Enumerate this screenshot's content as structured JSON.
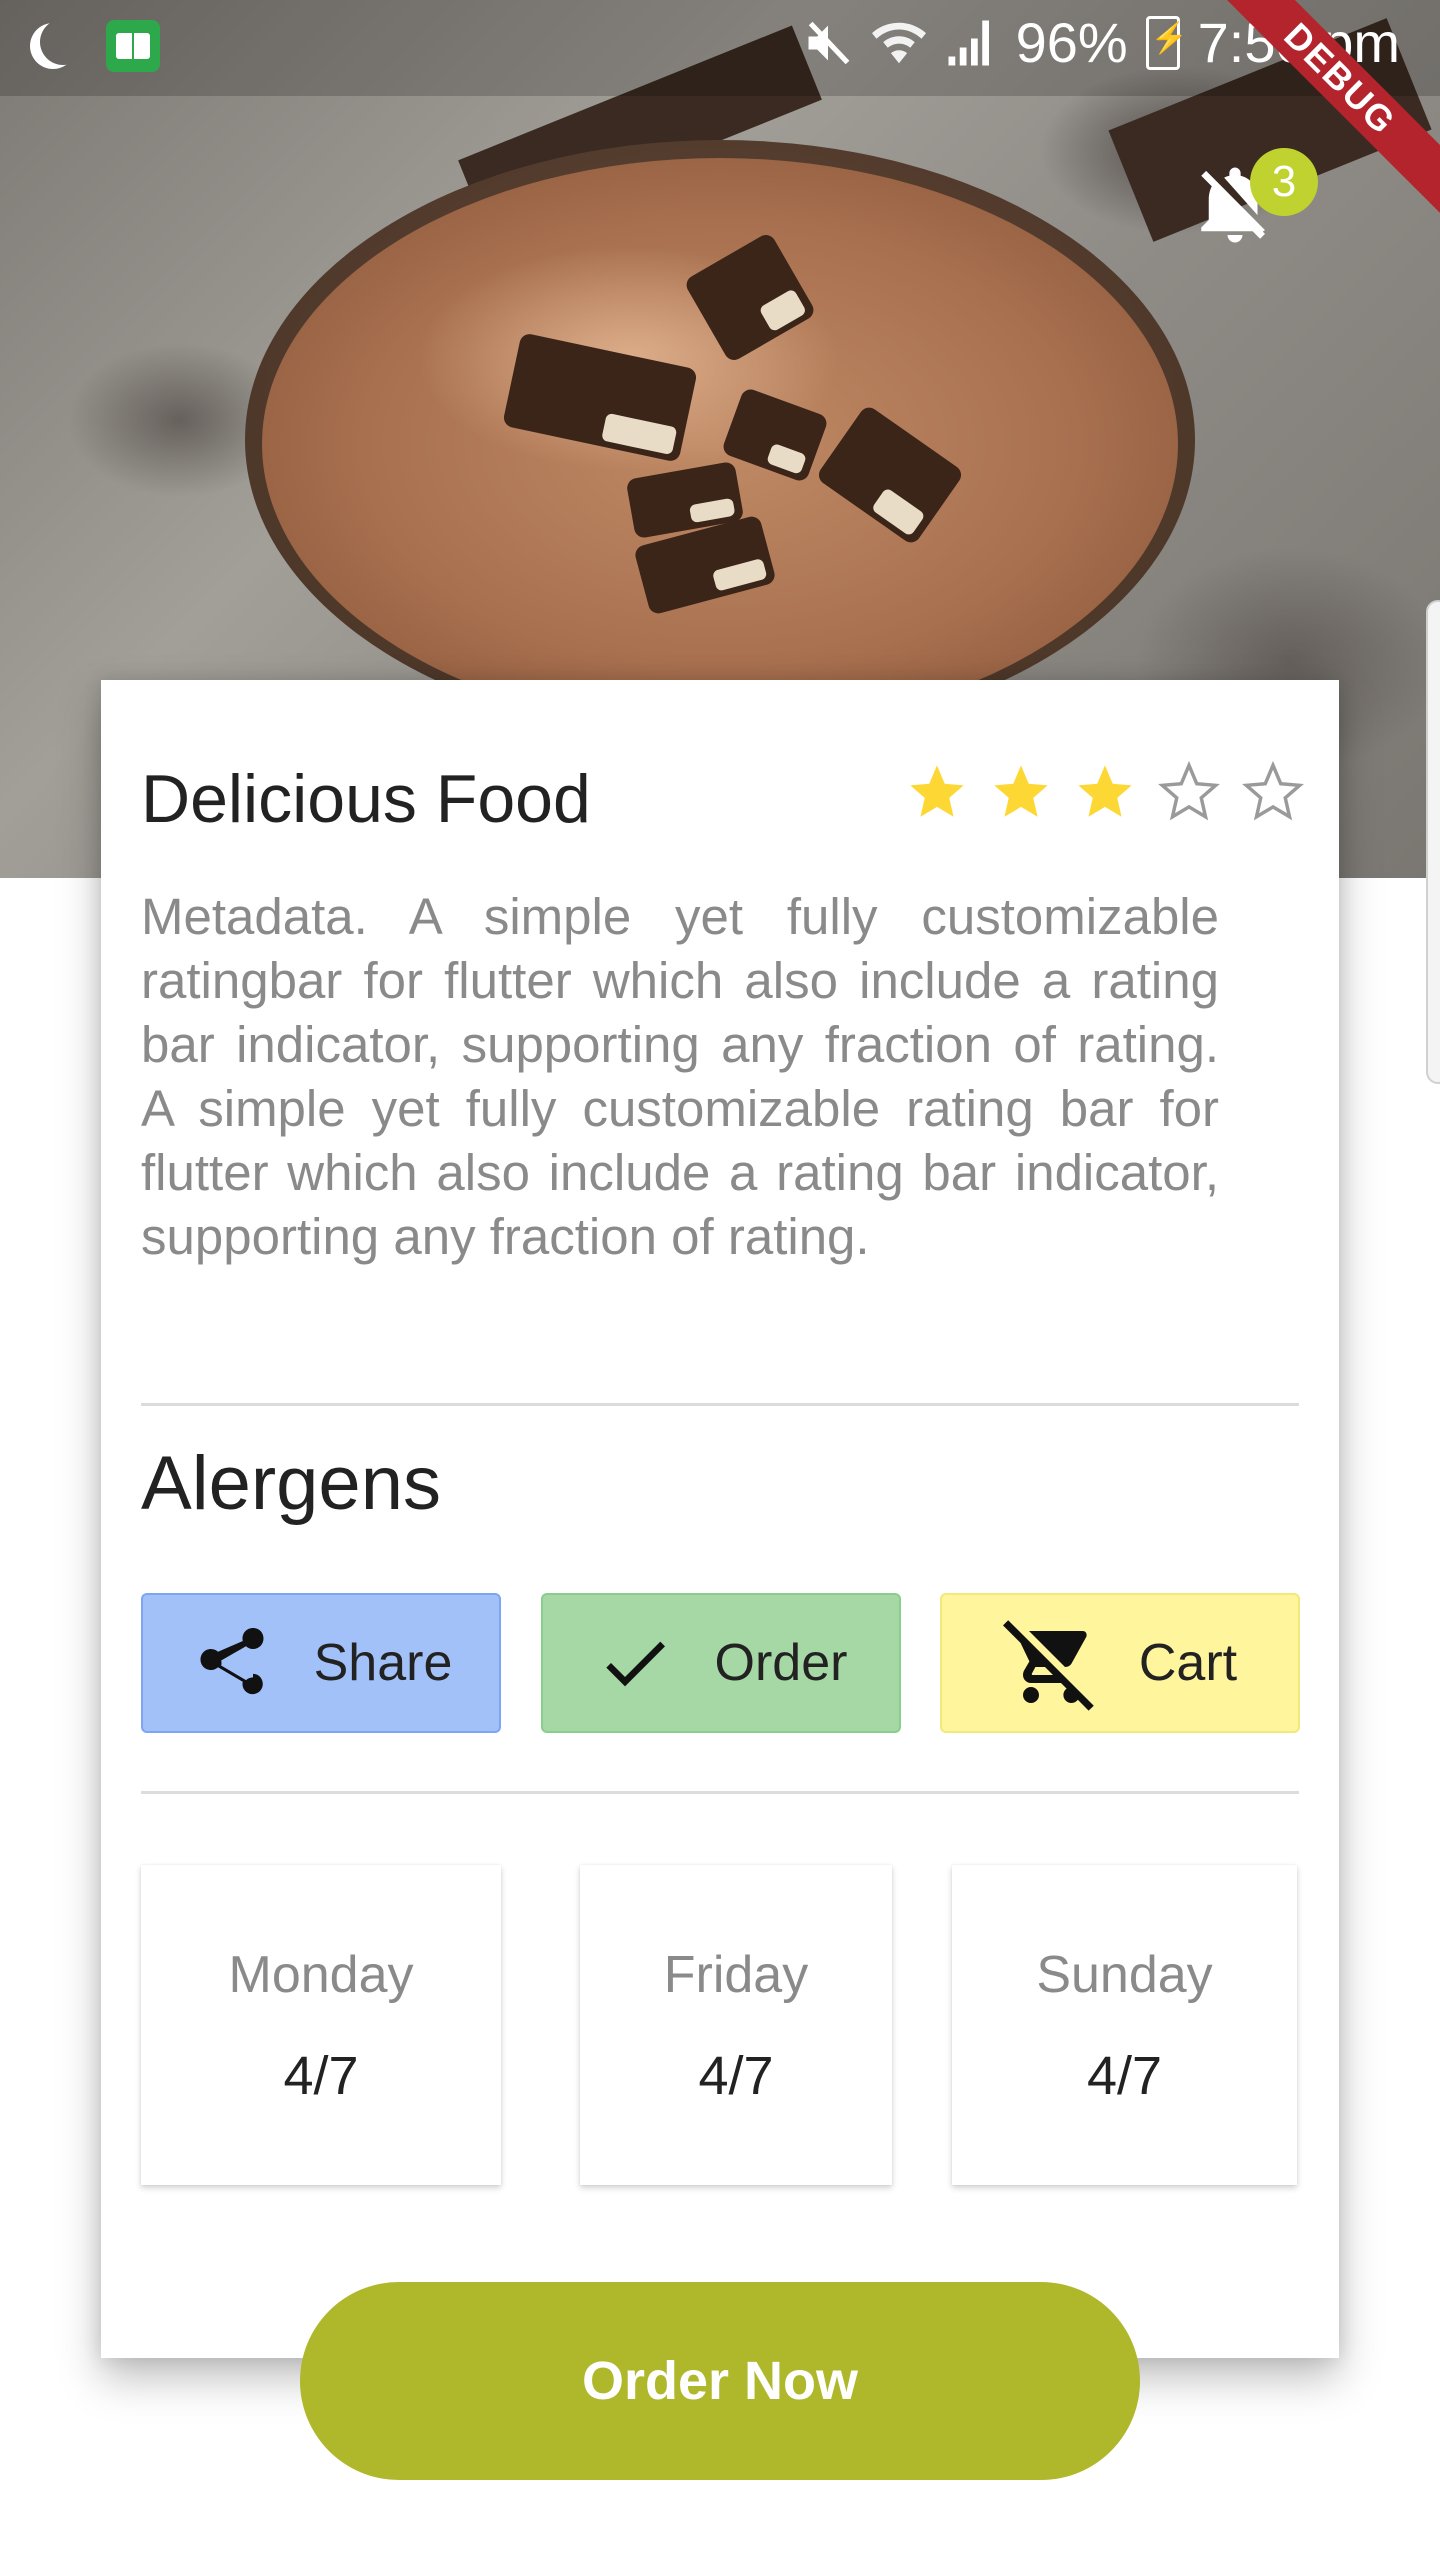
{
  "status_bar": {
    "battery": "96%",
    "time": "7:50 pm"
  },
  "debug_label": "DEBUG",
  "notifications": {
    "count": "3"
  },
  "item": {
    "title": "Delicious Food",
    "rating": 3,
    "rating_max": 5,
    "description": "Metadata. A simple yet fully customizable ratingbar for flutter which also include a rating bar indicator, supporting any fraction of rating. A simple yet fully customizable rating bar for flutter which also include a rating bar indicator, supporting any fraction of rating."
  },
  "allergens": {
    "title": "Alergens"
  },
  "actions": {
    "share": "Share",
    "order": "Order",
    "cart": "Cart"
  },
  "days": [
    {
      "name": "Monday",
      "value": "4/7"
    },
    {
      "name": "Friday",
      "value": "4/7"
    },
    {
      "name": "Sunday",
      "value": "4/7"
    }
  ],
  "cta": {
    "label": "Order Now"
  },
  "colors": {
    "star_filled": "#fdd835",
    "share_bg": "#a3c1f9",
    "order_bg": "#a5d8a5",
    "cart_bg": "#fff59c",
    "cta_bg": "#afb72b",
    "badge_bg": "#c0d22f",
    "debug_bg": "#b3242c"
  },
  "icons": {
    "share": "share-icon",
    "order": "check-icon",
    "cart": "remove-shopping-cart-icon",
    "bell": "notifications-off-icon"
  }
}
